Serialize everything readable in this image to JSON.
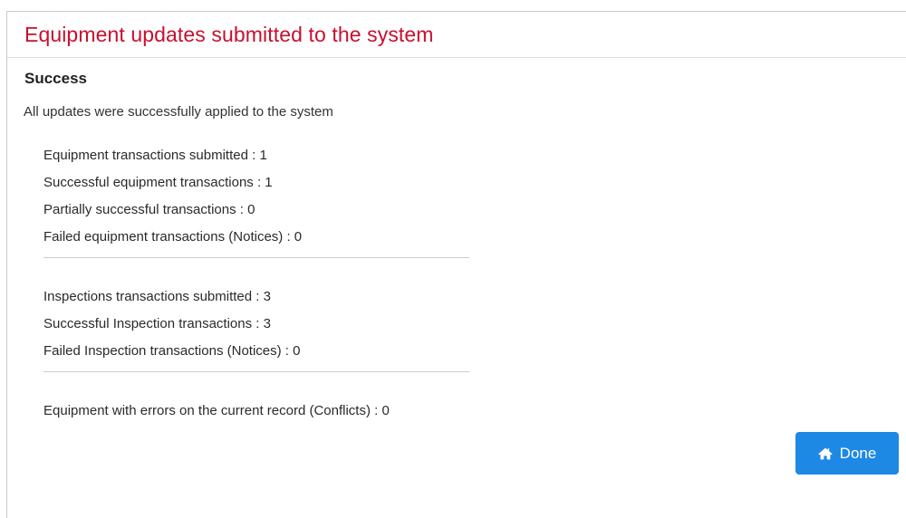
{
  "panel": {
    "title": "Equipment updates submitted to the system",
    "title_color": "#c8102e"
  },
  "status": {
    "heading": "Success",
    "message": "All updates were successfully applied to the system"
  },
  "equipment_stats": [
    "Equipment transactions submitted : 1",
    "Successful equipment transactions : 1",
    "Partially successful transactions : 0",
    "Failed equipment transactions (Notices) : 0"
  ],
  "inspection_stats": [
    "Inspections transactions submitted : 3",
    "Successful Inspection transactions : 3",
    "Failed Inspection transactions (Notices) : 0"
  ],
  "conflict_stats": [
    "Equipment with errors on the current record (Conflicts) : 0"
  ],
  "actions": {
    "done_label": "Done",
    "done_icon": "home-icon",
    "done_color": "#1e88e5"
  }
}
